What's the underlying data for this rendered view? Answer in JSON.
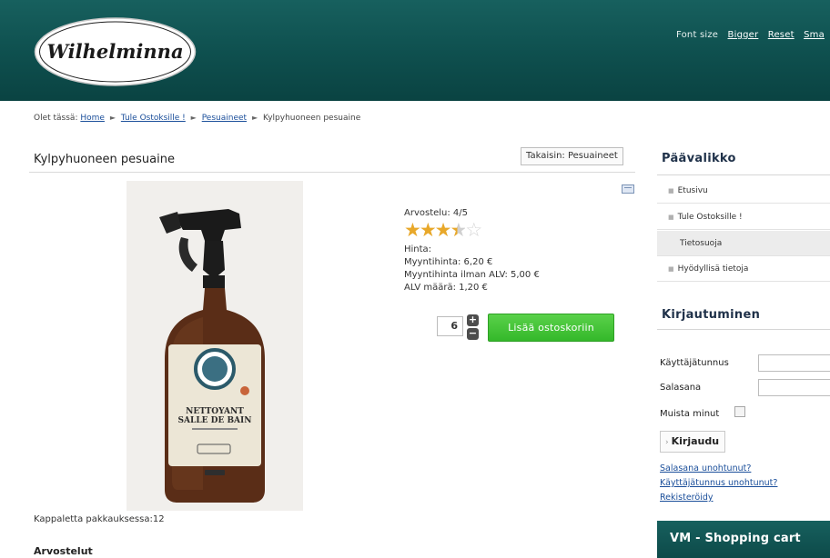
{
  "header": {
    "logo_text": "Wilhelminna",
    "font_size_label": "Font size",
    "bigger_label": "Bigger",
    "reset_label": "Reset",
    "smaller_label": "Sma"
  },
  "breadcrumb": {
    "prefix": "Olet tässä:",
    "items": [
      "Home",
      "Tule Ostoksille !",
      "Pesuaineet"
    ],
    "current": "Kylpyhuoneen pesuaine"
  },
  "product": {
    "title": "Kylpyhuoneen pesuaine",
    "back_label": "Takaisin: Pesuaineet",
    "rating_label": "Arvostelu: 4/5",
    "rating_value": 3.5,
    "rating_max": 5,
    "price_heading": "Hinta:",
    "price": "Myyntihinta: 6,20 €",
    "price_ex_vat": "Myyntihinta ilman ALV: 5,00 €",
    "vat": "ALV määrä: 1,20 €",
    "quantity": "6",
    "add_to_cart_label": "Lisää ostoskoriin",
    "per_pack": "Kappaletta pakkauksessa:12",
    "reviews_heading": "Arvostelut",
    "bottle_label_line1": "NETTOYANT",
    "bottle_label_line2": "SALLE DE BAIN"
  },
  "main_menu": {
    "heading": "Päävalikko",
    "items": [
      {
        "label": "Etusivu"
      },
      {
        "label": "Tule Ostoksille !"
      },
      {
        "label": "Tietosuoja"
      },
      {
        "label": "Hyödyllisä tietoja"
      }
    ]
  },
  "login": {
    "heading": "Kirjautuminen",
    "username_label": "Käyttäjätunnus",
    "password_label": "Salasana",
    "remember_label": "Muista minut",
    "login_button": "Kirjaudu",
    "forgot_password": "Salasana unohtunut?",
    "forgot_username": "Käyttäjätunnus unohtunut?",
    "register": "Rekisteröidy"
  },
  "cart": {
    "heading": "VM - Shopping cart"
  },
  "colors": {
    "header_teal": "#0e4f4e",
    "cart_button_green": "#3cbc30",
    "link_blue": "#1a4e9a",
    "star_gold": "#e8a82a"
  }
}
